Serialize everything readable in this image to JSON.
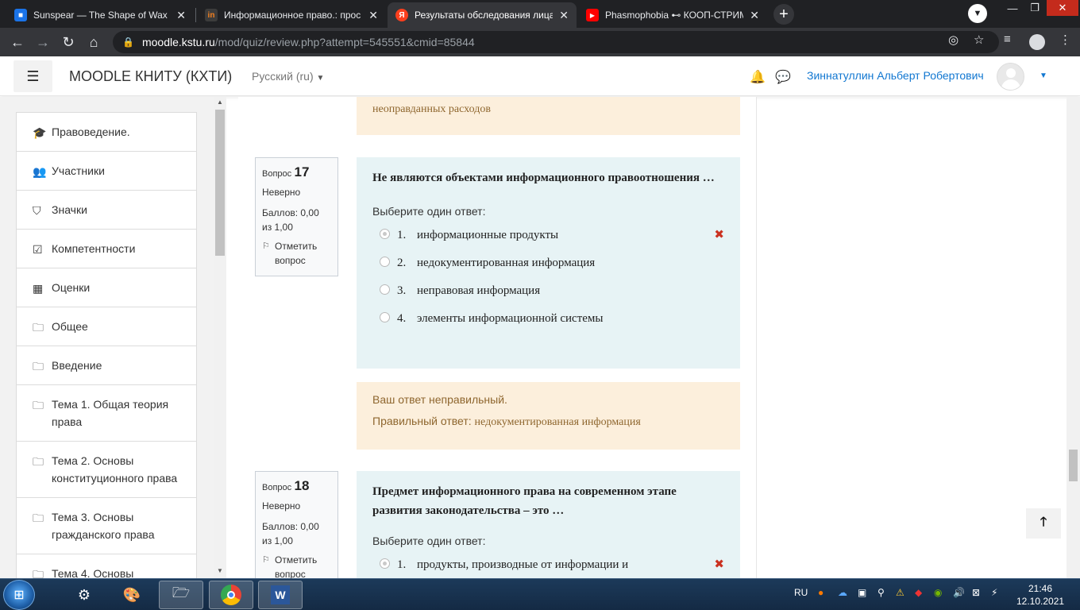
{
  "browser": {
    "tabs": [
      {
        "title": "Sunspear — The Shape of Wax",
        "favicon": "chat-icon",
        "color": "#1a73e8",
        "glyph": "■"
      },
      {
        "title": "Информационное право.: прос",
        "favicon": "in-icon",
        "color": "#f48120",
        "glyph": "in"
      },
      {
        "title": "Результаты обследования лица,",
        "favicon": "yandex-icon",
        "color": "#fc3f1d",
        "glyph": "Я"
      },
      {
        "title": "Phasmophobia ⊷ КООП-СТРИМ",
        "favicon": "youtube-icon",
        "color": "#ff0000",
        "glyph": "▶"
      }
    ],
    "close_glyph": "✕",
    "newtab_glyph": "+",
    "url_host": "moodle.kstu.ru",
    "url_path": "/mod/quiz/review.php?attempt=545551&cmid=85844"
  },
  "header": {
    "site_name": "MOODLE КНИТУ (КХТИ)",
    "language": "Русский (ru)",
    "user_name": "Зиннатуллин Альберт Робертович"
  },
  "nav": [
    {
      "label": "Правоведение.",
      "icon": "graduation-cap-icon",
      "glyph": "🎓"
    },
    {
      "label": "Участники",
      "icon": "users-icon",
      "glyph": "👥"
    },
    {
      "label": "Значки",
      "icon": "shield-icon",
      "glyph": "⛉"
    },
    {
      "label": "Компетентности",
      "icon": "checkbox-icon",
      "glyph": "☑"
    },
    {
      "label": "Оценки",
      "icon": "table-icon",
      "glyph": "▦"
    },
    {
      "label": "Общее",
      "icon": "folder-icon",
      "glyph": "🗀"
    },
    {
      "label": "Введение",
      "icon": "folder-icon",
      "glyph": "🗀"
    },
    {
      "label": "Тема 1. Общая теория права",
      "icon": "folder-icon",
      "glyph": "🗀"
    },
    {
      "label": "Тема 2. Основы конституционного права",
      "icon": "folder-icon",
      "glyph": "🗀"
    },
    {
      "label": "Тема 3. Основы гражданского права",
      "icon": "folder-icon",
      "glyph": "🗀"
    },
    {
      "label": "Тема 4. Основы",
      "icon": "folder-icon",
      "glyph": "🗀"
    }
  ],
  "top_feedback": "неоправданных расходов",
  "questions": [
    {
      "label": "Вопрос",
      "number": "17",
      "state": "Неверно",
      "grade": "Баллов: 0,00 из 1,00",
      "flag": "Отметить вопрос",
      "text": "Не являются объектами информационного правоотношения …",
      "prompt": "Выберите один ответ:",
      "answers": [
        {
          "num": "1.",
          "text": "информационные продукты",
          "selected": true,
          "wrong": true
        },
        {
          "num": "2.",
          "text": "недокументированная информация",
          "selected": false,
          "wrong": false
        },
        {
          "num": "3.",
          "text": "неправовая информация",
          "selected": false,
          "wrong": false
        },
        {
          "num": "4.",
          "text": "элементы информационной системы",
          "selected": false,
          "wrong": false
        }
      ],
      "feedback_status": "Ваш ответ неправильный.",
      "feedback_right_label": "Правильный ответ:",
      "feedback_right_value": "недокументированная информация"
    },
    {
      "label": "Вопрос",
      "number": "18",
      "state": "Неверно",
      "grade": "Баллов: 0,00 из 1,00",
      "flag": "Отметить вопрос",
      "text": "Предмет информационного права на современном этапе развития законодательства – это …",
      "prompt": "Выберите один ответ:",
      "answers": [
        {
          "num": "1.",
          "text": "продукты, производные от информации и",
          "selected": true,
          "wrong": true
        }
      ]
    }
  ],
  "taskbar": {
    "lang": "RU",
    "time": "21:46",
    "date": "12.10.2021"
  },
  "colors": {
    "link_blue": "#1177d1",
    "question_bg": "#e7f3f5",
    "feedback_bg": "#fcefdc",
    "feedback_text": "#8e662e",
    "wrong_red": "#ca3120"
  }
}
